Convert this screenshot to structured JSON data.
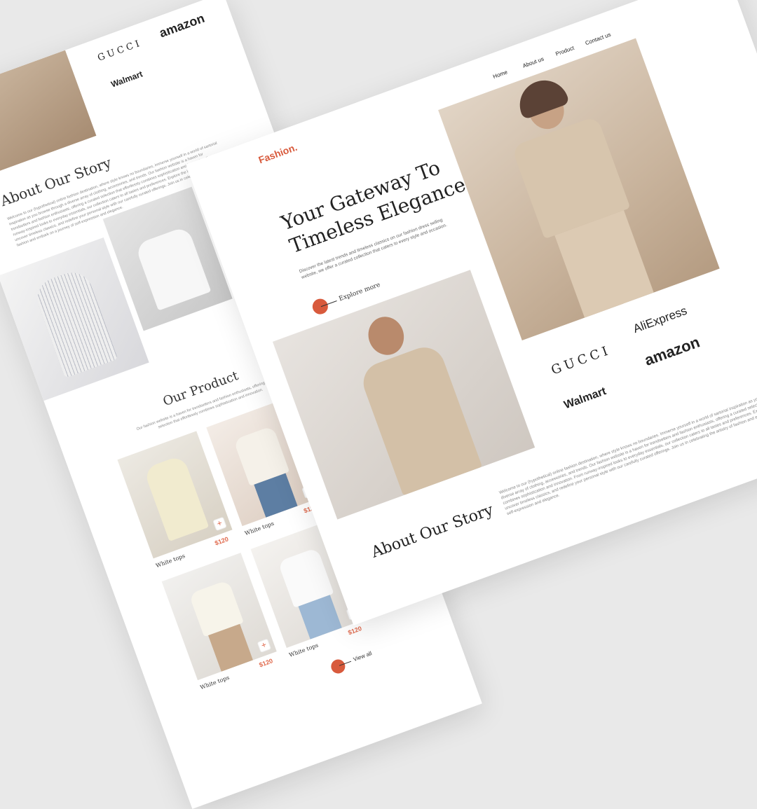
{
  "back_page": {
    "brands": {
      "gucci": "GUCCI",
      "amazon": "amazon",
      "walmart": "Walmart"
    },
    "about": {
      "title": "About Our Story",
      "text": "Welcome to our (hypothetical) online fashion destination, where style knows no boundaries, immerse yourself in a world of sartorial inspiration as you browse through a diverse array of clothing, accessories, and trends. Our fashion website is a haven for trendsetters and fashion enthusiasts, offering a curated selection that effortlessly combines sophistication and innovation. From runway-inspired looks to everyday essentials, our collection caters to all tastes and preferences. Explore the latest designs, uncover timeless classics, and redefine your personal style with our carefully curated offerings. Join us in celebrating the artistry of fashion and embark on a journey of self-expression and elegance."
    },
    "products": {
      "title": "Our Product",
      "subtitle": "Our fashion website is a haven for trendsetters and fashion enthusiasts, offering a curated selection that effortlessly combines sophistication and innovation.",
      "items": [
        {
          "name": "White tops",
          "price": "$120"
        },
        {
          "name": "White tops",
          "price": "$120"
        },
        {
          "name": "White tops",
          "price": "$120"
        },
        {
          "name": "White tops",
          "price": "$120"
        }
      ],
      "view_all": "View all",
      "plus": "+"
    }
  },
  "front_page": {
    "logo": "Fashion.",
    "nav": [
      "Home",
      "About us",
      "Product",
      "Contact us"
    ],
    "hero": {
      "title_line1": "Your Gateway To",
      "title_line2": "Timeless Elegance",
      "description": "Discover the latest trends and timeless classics on our fashion dress selling website, we offer a curated collection that caters to every style and occasion.",
      "cta": "Explore more"
    },
    "brands": {
      "gucci": "GUCCI",
      "aliexpress": "AliExpress",
      "amazon": "amazon",
      "walmart": "Walmart"
    },
    "about": {
      "title": "About Our Story",
      "text": "Welcome to our (hypothetical) online fashion destination, where style knows no boundaries. Immerse yourself in a world of sartorial inspiration as you browse through a diverse array of clothing, accessories, and trends. Our fashion website is a haven for trendsetters and fashion enthusiasts, offering a curated selection that effortlessly combines sophistication and innovation. From runway-inspired looks to everyday essentials, our collection caters to all tastes and preferences. Explore the latest designs, uncover timeless classics, and redefine your personal style with our carefully curated offerings. Join us in celebrating the artistry of fashion and embark on a journey of self-expression and elegance."
    }
  },
  "colors": {
    "accent": "#e06a4d",
    "background": "#e9e9e9",
    "beige": "#d9c8b4"
  }
}
